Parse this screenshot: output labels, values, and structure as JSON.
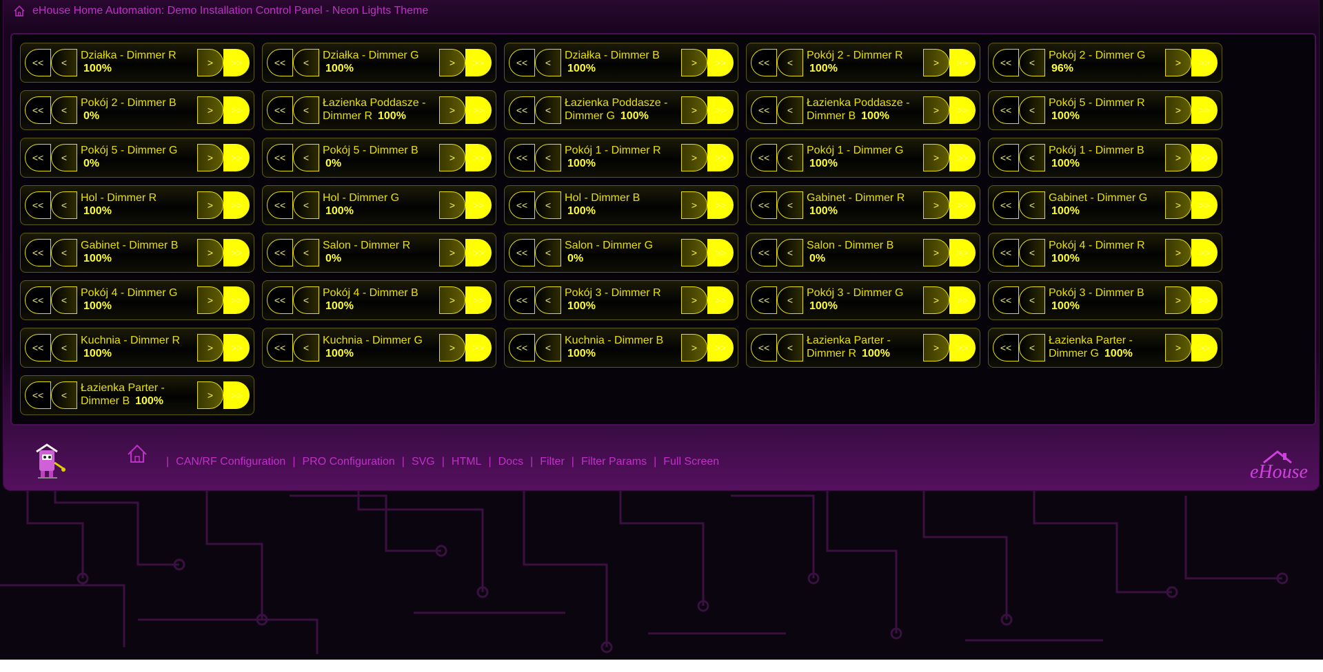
{
  "header": {
    "title": "eHouse Home Automation: Demo Installation Control Panel - Neon Lights Theme"
  },
  "buttons": {
    "fast_down": "<<",
    "down": "<",
    "up": ">",
    "fast_up": ">>"
  },
  "dimmers": [
    {
      "label": "Działka - Dimmer R",
      "value": "100%",
      "inline": false
    },
    {
      "label": "Działka - Dimmer G",
      "value": "100%",
      "inline": false
    },
    {
      "label": "Działka - Dimmer B",
      "value": "100%",
      "inline": false
    },
    {
      "label": "Pokój 2 - Dimmer R",
      "value": "100%",
      "inline": false
    },
    {
      "label": "Pokój 2 - Dimmer G",
      "value": "96%",
      "inline": false
    },
    {
      "label": "Pokój 2 - Dimmer B",
      "value": "0%",
      "inline": false
    },
    {
      "label": "Łazienka Poddasze - Dimmer R",
      "value": "100%",
      "inline": true
    },
    {
      "label": "Łazienka Poddasze - Dimmer G",
      "value": "100%",
      "inline": true
    },
    {
      "label": "Łazienka Poddasze - Dimmer B",
      "value": "100%",
      "inline": true
    },
    {
      "label": "Pokój 5 - Dimmer R",
      "value": "100%",
      "inline": false
    },
    {
      "label": "Pokój 5 - Dimmer G",
      "value": "0%",
      "inline": false
    },
    {
      "label": "Pokój 5 - Dimmer B",
      "value": "0%",
      "inline": false
    },
    {
      "label": "Pokój 1 - Dimmer R",
      "value": "100%",
      "inline": false
    },
    {
      "label": "Pokój 1 - Dimmer G",
      "value": "100%",
      "inline": false
    },
    {
      "label": "Pokój 1 - Dimmer B",
      "value": "100%",
      "inline": false
    },
    {
      "label": "Hol - Dimmer R",
      "value": "100%",
      "inline": false
    },
    {
      "label": "Hol - Dimmer G",
      "value": "100%",
      "inline": false
    },
    {
      "label": "Hol - Dimmer B",
      "value": "100%",
      "inline": false
    },
    {
      "label": "Gabinet - Dimmer R",
      "value": "100%",
      "inline": false
    },
    {
      "label": "Gabinet - Dimmer G",
      "value": "100%",
      "inline": false
    },
    {
      "label": "Gabinet - Dimmer B",
      "value": "100%",
      "inline": false
    },
    {
      "label": "Salon - Dimmer R",
      "value": "0%",
      "inline": false
    },
    {
      "label": "Salon - Dimmer G",
      "value": "0%",
      "inline": false
    },
    {
      "label": "Salon - Dimmer B",
      "value": "0%",
      "inline": false
    },
    {
      "label": "Pokój 4 - Dimmer R",
      "value": "100%",
      "inline": false
    },
    {
      "label": "Pokój 4 - Dimmer G",
      "value": "100%",
      "inline": false
    },
    {
      "label": "Pokój 4 - Dimmer B",
      "value": "100%",
      "inline": false
    },
    {
      "label": "Pokój 3 - Dimmer R",
      "value": "100%",
      "inline": false
    },
    {
      "label": "Pokój 3 - Dimmer G",
      "value": "100%",
      "inline": false
    },
    {
      "label": "Pokój 3 - Dimmer B",
      "value": "100%",
      "inline": false
    },
    {
      "label": "Kuchnia - Dimmer R",
      "value": "100%",
      "inline": false
    },
    {
      "label": "Kuchnia - Dimmer G",
      "value": "100%",
      "inline": false
    },
    {
      "label": "Kuchnia - Dimmer B",
      "value": "100%",
      "inline": false
    },
    {
      "label": "Łazienka Parter - Dimmer R",
      "value": "100%",
      "inline": true
    },
    {
      "label": "Łazienka Parter - Dimmer G",
      "value": "100%",
      "inline": true
    },
    {
      "label": "Łazienka Parter - Dimmer B",
      "value": "100%",
      "inline": true
    }
  ],
  "footer": {
    "separator": "|",
    "links": [
      "CAN/RF Configuration",
      "PRO Configuration",
      "SVG",
      "HTML",
      "Docs",
      "Filter",
      "Filter Params",
      "Full Screen"
    ]
  },
  "icons": {
    "title": "home-icon",
    "footer_home": "home-icon",
    "mascot": "ehouse-mascot-logo",
    "brand": "ehouse-brand-logo"
  },
  "colors": {
    "accent_magenta": "#c030c8",
    "neon_yellow": "#ffff00",
    "label_yellow": "#e8e000",
    "panel_bg": "#06030a"
  }
}
